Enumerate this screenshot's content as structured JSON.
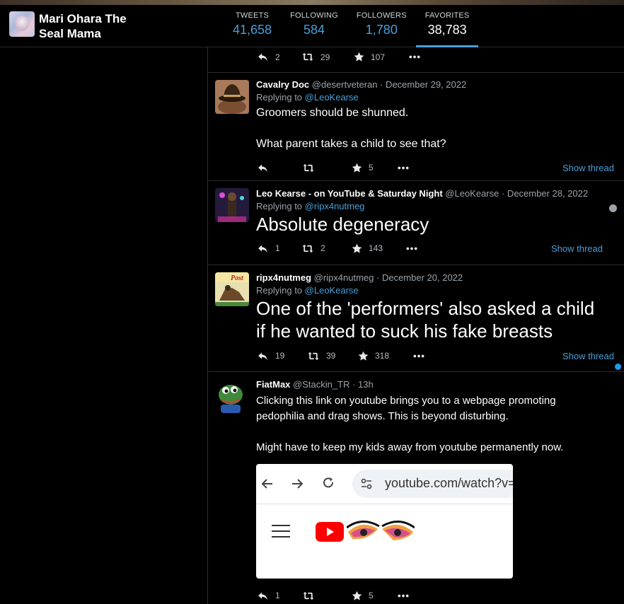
{
  "profile": {
    "name": "Mari Ohara The Seal Mama"
  },
  "stats": [
    {
      "label": "TWEETS",
      "value": "41,658"
    },
    {
      "label": "FOLLOWING",
      "value": "584"
    },
    {
      "label": "FOLLOWERS",
      "value": "1,780"
    },
    {
      "label": "FAVORITES",
      "value": "38,783"
    }
  ],
  "top_actions": {
    "replies": "2",
    "retweets": "29",
    "likes": "107"
  },
  "tweets": [
    {
      "name": "Cavalry Doc",
      "handle": "@desertveteran",
      "date": "· December 29, 2022",
      "reply_prefix": "Replying to",
      "reply_to": "@LeoKearse",
      "line1": "Groomers should be shunned.",
      "line2": "What parent takes a child to see that?",
      "replies": "",
      "retweets": "",
      "likes": "5",
      "show_thread": "Show thread"
    },
    {
      "name": "Leo Kearse - on YouTube & Saturday Night",
      "handle": "@LeoKearse",
      "date": "· December 28, 2022",
      "reply_prefix": "Replying to",
      "reply_to": "@ripx4nutmeg",
      "line1": "Absolute degeneracy",
      "replies": "1",
      "retweets": "2",
      "likes": "143",
      "show_thread": "Show thread"
    },
    {
      "name": "ripx4nutmeg",
      "handle": "@ripx4nutmeg",
      "date": "· December 20, 2022",
      "reply_prefix": "Replying to",
      "reply_to": "@LeoKearse",
      "line1": "One of the 'performers' also asked a child",
      "line2": "if he wanted to suck his fake breasts",
      "avatar_text": "Post",
      "replies": "19",
      "retweets": "39",
      "likes": "318",
      "show_thread": "Show thread"
    },
    {
      "name": "FiatMax",
      "handle": "@Stackin_TR",
      "date": "· 13h",
      "line1": "Clicking this link on youtube brings you to a webpage promoting",
      "line2": "pedophilia and drag shows.  This is beyond disturbing.",
      "line3": "Might have to keep my kids away from youtube permanently now.",
      "embed_url": "youtube.com/watch?v=",
      "replies": "1",
      "retweets": "",
      "likes": "5"
    }
  ],
  "colors": {
    "accent": "#4a9fd8",
    "background": "#000000",
    "unread_dot": "#1d9bf0"
  }
}
